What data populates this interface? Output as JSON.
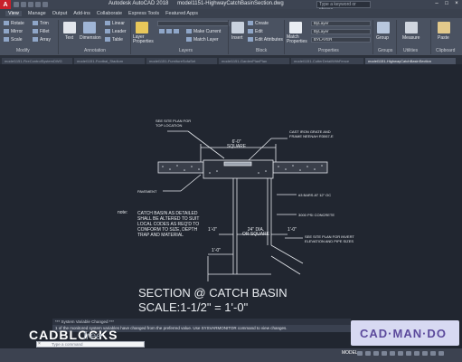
{
  "titlebar": {
    "app_name": "Autodesk AutoCAD 2018",
    "file_name": "model1151-HighwayCatchBasinSection.dwg",
    "search_placeholder": "Type a keyword or phrase"
  },
  "ribbon_tabs": [
    "View",
    "Manage",
    "Output",
    "Add-ins",
    "Collaborate",
    "Express Tools",
    "Featured Apps"
  ],
  "ribbon": {
    "modify": {
      "label": "Modify",
      "rows": [
        [
          "Rotate",
          "Trim"
        ],
        [
          "Mirror",
          "Fillet"
        ],
        [
          "Scale",
          "Array"
        ]
      ]
    },
    "text_label": "Text",
    "dimension_label": "Dimension",
    "annotation": {
      "label": "Annotation",
      "items": [
        "Linear",
        "Leader",
        "Table"
      ]
    },
    "layer_properties_label": "Layer Properties",
    "layers": {
      "label": "Layers",
      "items": [
        "Make Current",
        "Match Layer"
      ]
    },
    "block": {
      "label": "Block",
      "insert_label": "Insert",
      "items": [
        "Create",
        "Edit",
        "Edit Attributes"
      ]
    },
    "match_properties_label": "Match Properties",
    "properties": {
      "label": "Properties",
      "values": [
        "ByLayer",
        "ByLayer",
        "BYLAYER"
      ]
    },
    "groups": {
      "label": "Groups",
      "group_label": "Group"
    },
    "utilities": {
      "label": "Utilities",
      "measure_label": "Measure"
    },
    "clipboard": {
      "label": "Clipboard",
      "paste_label": "Paste"
    }
  },
  "doc_tabs": [
    "model1151-FireControlSystemDWG",
    "model1151-Footbal_Stadium",
    "model1151-FurnitureSofaSet",
    "model1151-GardenPlanPlan",
    "model1151-CutterDetailWithFence",
    "model1151-HighwayCatchBasinSection"
  ],
  "active_doc_tab_index": 5,
  "drawing": {
    "top_note": [
      "SEE SITE PLAN FOR",
      "TOP LOCATION"
    ],
    "grate_note": [
      "CAST IRON GRATE AND",
      "FRAME NEENAH R3067-E"
    ],
    "width_dim": [
      "6'-0\"",
      "SQUARE"
    ],
    "pavement_label": "PAVEMENT",
    "rebar_note": "#3 BARS AT 12\" OC",
    "concrete_note": "3000 PSI CONCRETE",
    "invert_note": [
      "SEE SITE PLAN FOR INVERT",
      "ELEVATION AND PIPE SIZES"
    ],
    "note_label": "note:",
    "note_text": [
      "CATCH BASIN AS DETAILED",
      "SHALL BE ALTERED TO SUIT",
      "LOCAL CODES AS REQ'D TO",
      "CONFORM TO SIZE, DEPTH",
      "TRAP AND MATERIAL"
    ],
    "dim_left": "1'-0\"",
    "dim_center": [
      "24\" DIA.",
      "OR SQUARE"
    ],
    "dim_right": "1'-0\"",
    "dim_bottom": "1'-0\"",
    "section_title": "SECTION @ CATCH BASIN",
    "scale_title": "SCALE:1-1/2\" = 1'-0\""
  },
  "command": {
    "history_line1": "*** System Variable Changed ***",
    "history_line2": "1 of the monitored system variables have changed from the preferred value. Use SYSVARMONITOR command to view changes.",
    "input_placeholder": "Type a command"
  },
  "watermark": {
    "left_brand": "CADBLOCKS",
    "left_suffix": "free",
    "left_url": "www.cadblocksfree.com",
    "right_brand": "CAD·MAN·DO"
  },
  "statusbar": {
    "model_label": "MODEL"
  }
}
